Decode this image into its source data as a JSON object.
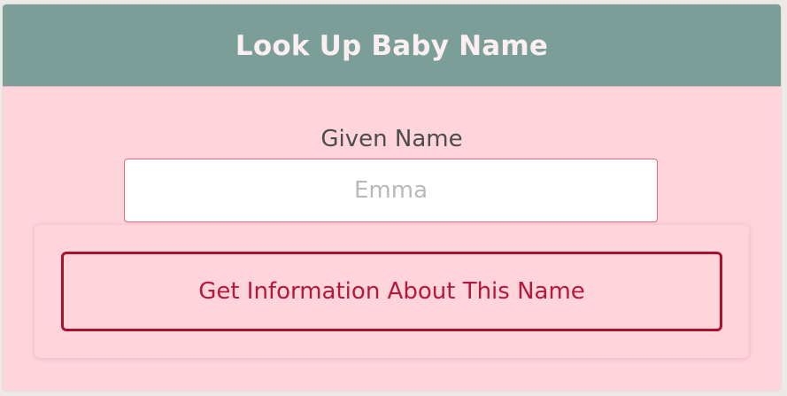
{
  "header": {
    "title": "Look Up Baby Name"
  },
  "form": {
    "given_name_label": "Given Name",
    "given_name_placeholder": "Emma",
    "given_name_value": "",
    "submit_label": "Get Information About This Name"
  },
  "colors": {
    "header_background": "#7b9f98",
    "card_background": "#ffd4da",
    "button_border": "#a8102e",
    "button_text": "#b5183e",
    "input_border": "#d96a86"
  }
}
